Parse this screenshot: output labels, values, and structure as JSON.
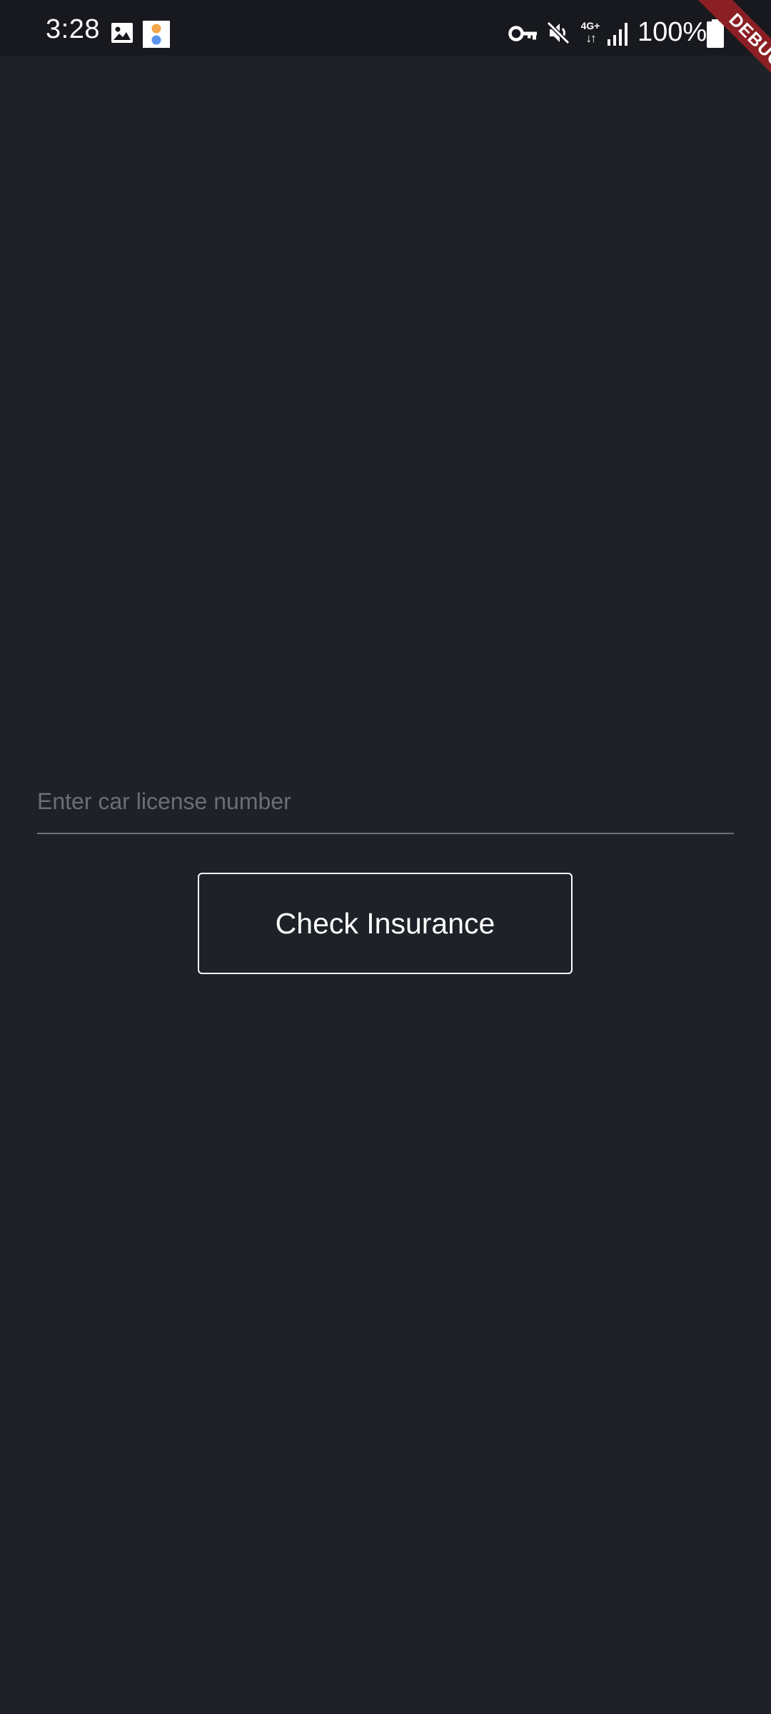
{
  "status_bar": {
    "time": "3:28",
    "battery_percent": "100%",
    "network_type": "4G+",
    "network_arrows": "↓↑",
    "icons": [
      "gallery-icon",
      "app-notification-icon",
      "vpn-key-icon",
      "mute-icon",
      "network-type-indicator",
      "signal-icon",
      "battery-icon"
    ]
  },
  "debug_banner": {
    "label": "DEBUG",
    "color": "#8b1f24"
  },
  "form": {
    "license_input": {
      "placeholder": "Enter car license number",
      "value": ""
    },
    "check_button_label": "Check Insurance"
  },
  "colors": {
    "background": "#1f2128",
    "status_bar": "#17191e",
    "placeholder": "#6b6e74",
    "underline": "#6f7278",
    "button_border": "#ffffff"
  }
}
